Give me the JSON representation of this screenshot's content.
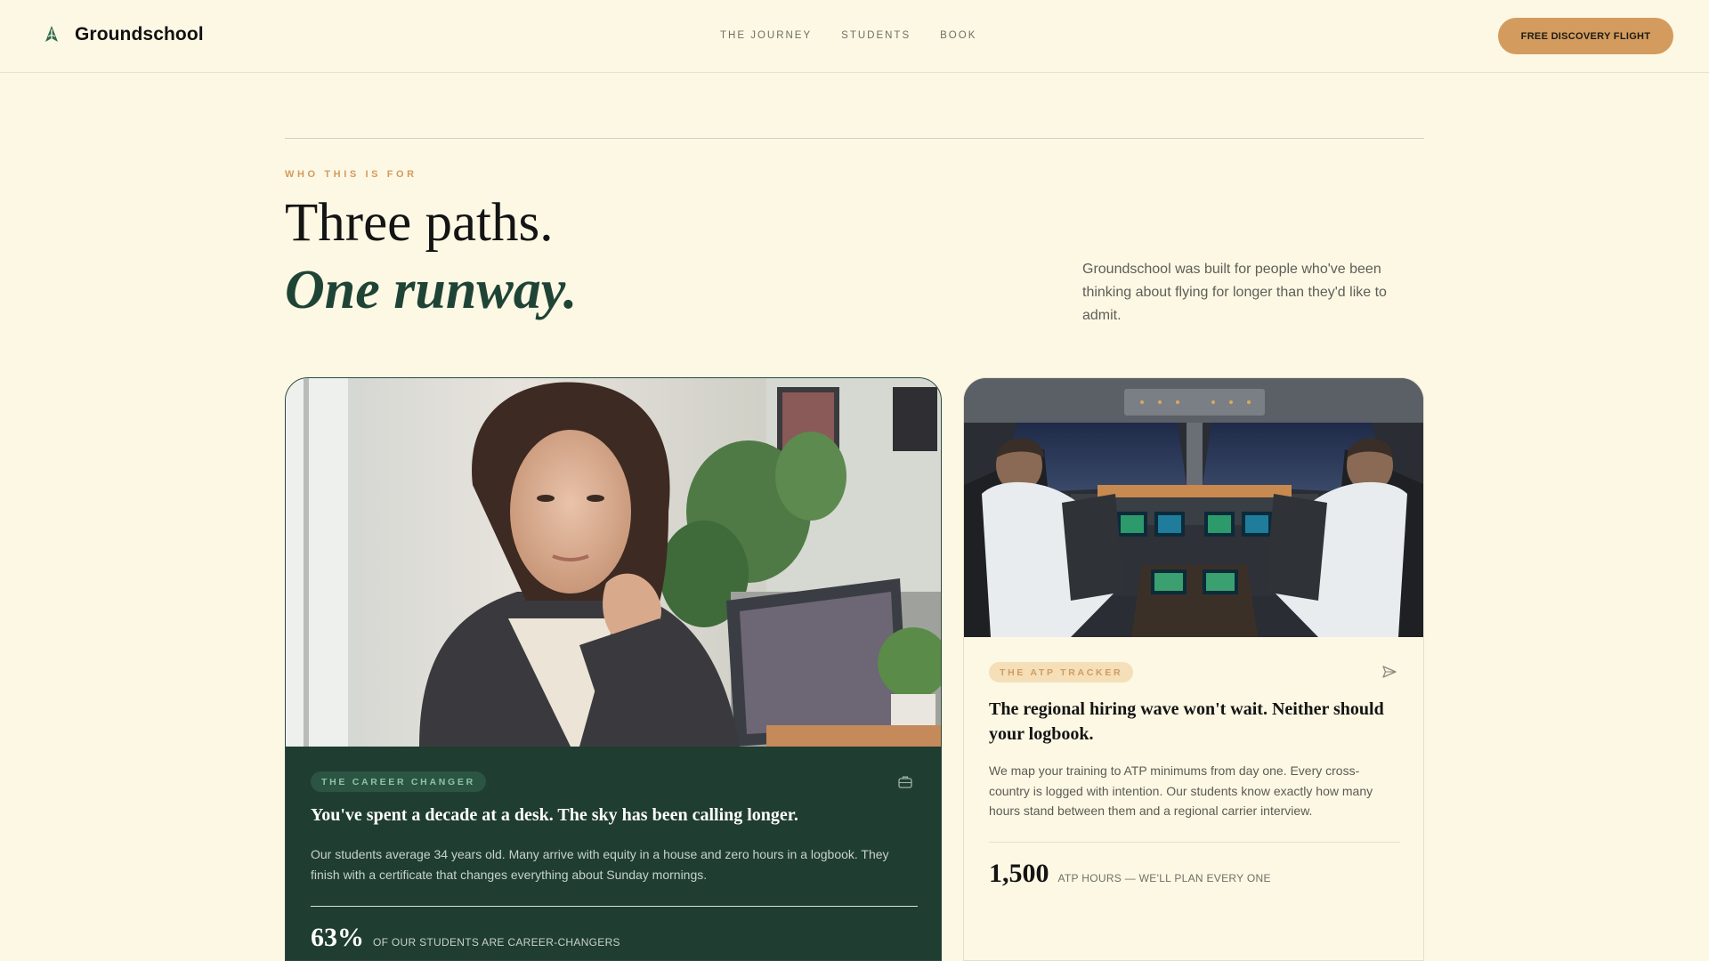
{
  "brand": {
    "name": "Groundschool",
    "icon": "plane-leaf-icon"
  },
  "nav": {
    "links": [
      "THE JOURNEY",
      "STUDENTS",
      "BOOK"
    ],
    "cta": "FREE DISCOVERY FLIGHT"
  },
  "section": {
    "eyebrow": "WHO THIS IS FOR",
    "heading_line1": "Three paths.",
    "heading_line2": "One runway.",
    "intro": "Groundschool was built for people who've been thinking about flying for longer than they'd like to admit."
  },
  "cards": [
    {
      "tag": "THE CAREER CHANGER",
      "icon": "briefcase-icon",
      "title": "You've spent a decade at a desk. The sky has been calling longer.",
      "body": "Our students average 34 years old. Many arrive with equity in a house and zero hours in a logbook. They finish with a certificate that changes everything about Sunday mornings.",
      "stat_value": "63%",
      "stat_label": "OF OUR STUDENTS ARE CAREER-CHANGERS"
    },
    {
      "tag": "THE ATP TRACKER",
      "icon": "paper-plane-icon",
      "title": "The regional hiring wave won't wait. Neither should your logbook.",
      "body": "We map your training to ATP minimums from day one. Every cross-country is logged with intention. Our students know exactly how many hours stand between them and a regional carrier interview.",
      "stat_value": "1,500",
      "stat_label": "ATP HOURS — WE'LL PLAN EVERY ONE"
    }
  ],
  "colors": {
    "background": "#fdf8e4",
    "accent": "#d39b5e",
    "forest": "#1f3d31",
    "heading_italic": "#1f4436"
  }
}
